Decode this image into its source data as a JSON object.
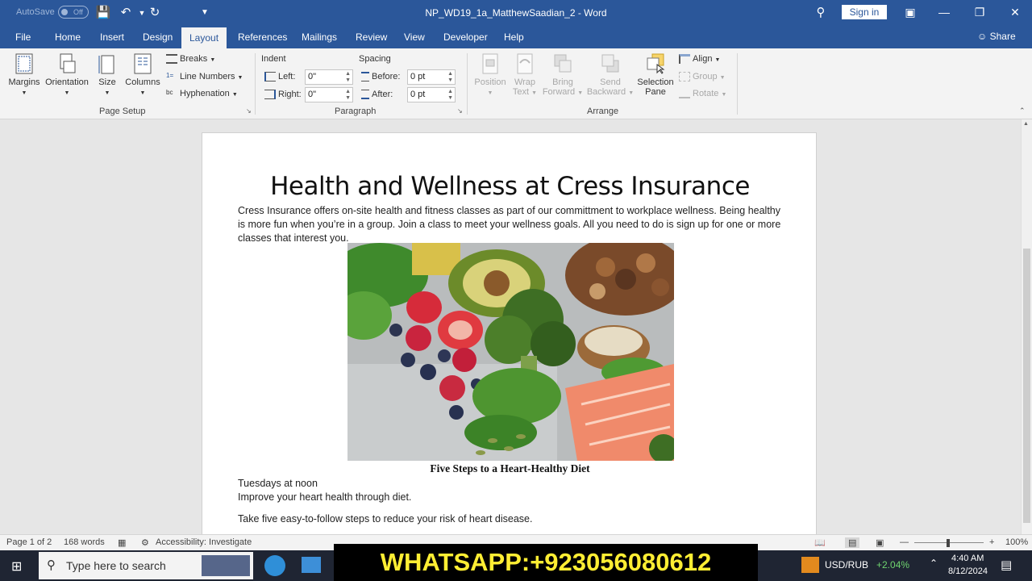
{
  "titlebar": {
    "autosave_label": "AutoSave",
    "autosave_state": "Off",
    "doc_title": "NP_WD19_1a_MatthewSaadian_2  -  Word",
    "signin": "Sign in"
  },
  "tabs": [
    {
      "label": "File"
    },
    {
      "label": "Home"
    },
    {
      "label": "Insert"
    },
    {
      "label": "Design"
    },
    {
      "label": "Layout"
    },
    {
      "label": "References"
    },
    {
      "label": "Mailings"
    },
    {
      "label": "Review"
    },
    {
      "label": "View"
    },
    {
      "label": "Developer"
    },
    {
      "label": "Help"
    }
  ],
  "share_label": "Share",
  "ribbon": {
    "page_setup": {
      "margins": "Margins",
      "orientation": "Orientation",
      "size": "Size",
      "columns": "Columns",
      "breaks": "Breaks",
      "line_numbers": "Line Numbers",
      "hyphenation": "Hyphenation",
      "label": "Page Setup"
    },
    "paragraph": {
      "indent": "Indent",
      "spacing": "Spacing",
      "left": "Left:",
      "right": "Right:",
      "before": "Before:",
      "after": "After:",
      "left_value": "0\"",
      "right_value": "0\"",
      "before_value": "0 pt",
      "after_value": "0 pt",
      "label": "Paragraph"
    },
    "arrange": {
      "position": "Position",
      "wrap_1": "Wrap",
      "wrap_2": "Text",
      "bring_1": "Bring",
      "bring_2": "Forward",
      "send_1": "Send",
      "send_2": "Backward",
      "selection_1": "Selection",
      "selection_2": "Pane",
      "align": "Align",
      "group": "Group",
      "rotate": "Rotate",
      "label": "Arrange"
    }
  },
  "document": {
    "heading": "Health and Wellness at Cress Insurance",
    "intro": "Cress Insurance offers on-site health and fitness classes as part of our committment to workplace wellness. Being healthy is more fun when you’re in a group. Join a class to meet your wellness goals. All you need to do is sign up for one or more classes that interest you.",
    "caption": "Five Steps to a Heart-Healthy Diet",
    "line1": "Tuesdays at noon",
    "line2": "Improve your heart health through diet.",
    "line3": "Take five easy-to-follow steps to reduce your risk of heart disease."
  },
  "status": {
    "page": "Page 1 of 2",
    "words": "168 words",
    "accessibility": "Accessibility: Investigate",
    "zoom": "100%"
  },
  "taskbar": {
    "search_placeholder": "Type here to search",
    "currency": "USD/RUB",
    "currency_change": "+2.04%",
    "time": "4:40 AM",
    "date": "8/12/2024"
  },
  "overlay": {
    "whatsapp": "WHATSAPP:+923056080612"
  },
  "colors": {
    "word_blue": "#2b579a",
    "ribbon_bg": "#f3f3f3",
    "overlay_text": "#ffee33"
  }
}
